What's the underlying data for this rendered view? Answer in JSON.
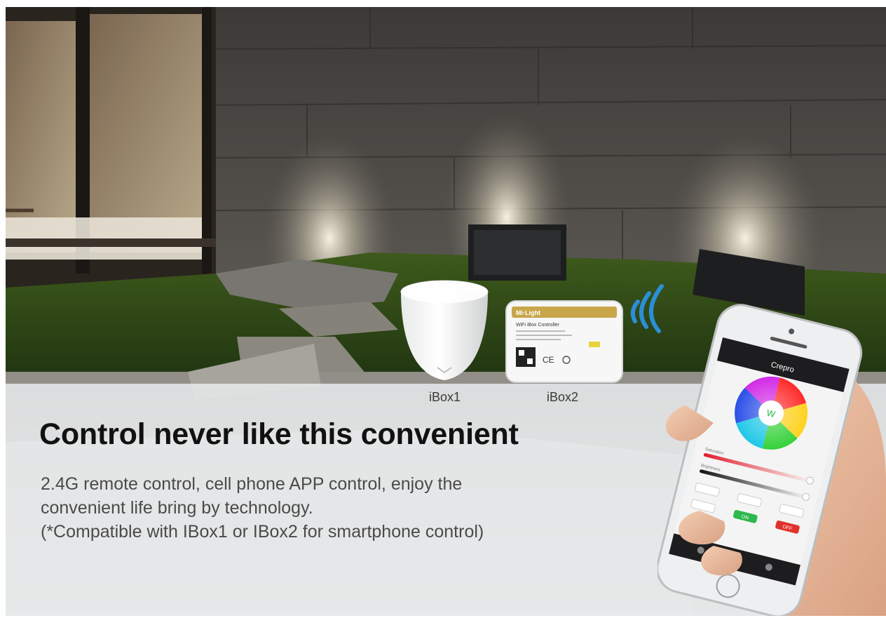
{
  "headline": "Control never like this convenient",
  "description": [
    "2.4G remote control, cell phone APP control, enjoy the",
    "convenient life bring by technology.",
    "(*Compatible with IBox1 or IBox2 for smartphone control)"
  ],
  "devices": [
    {
      "label": "iBox1"
    },
    {
      "label": "iBox2"
    }
  ],
  "ibox2_face": {
    "brand": "Mi·Light",
    "title": "WiFi iBox Controller"
  },
  "phone_app": {
    "title": "Crepro",
    "center_label": "W",
    "sliders": [
      "Saturation",
      "Brightness"
    ],
    "on_label": "ON",
    "off_label": "OFF"
  },
  "colors": {
    "panel": "#ebeef0",
    "headline": "#111111",
    "body_text": "#4a4a4a",
    "signal": "#2a8fd6",
    "on_button": "#2db84b",
    "off_button": "#e0322a"
  }
}
